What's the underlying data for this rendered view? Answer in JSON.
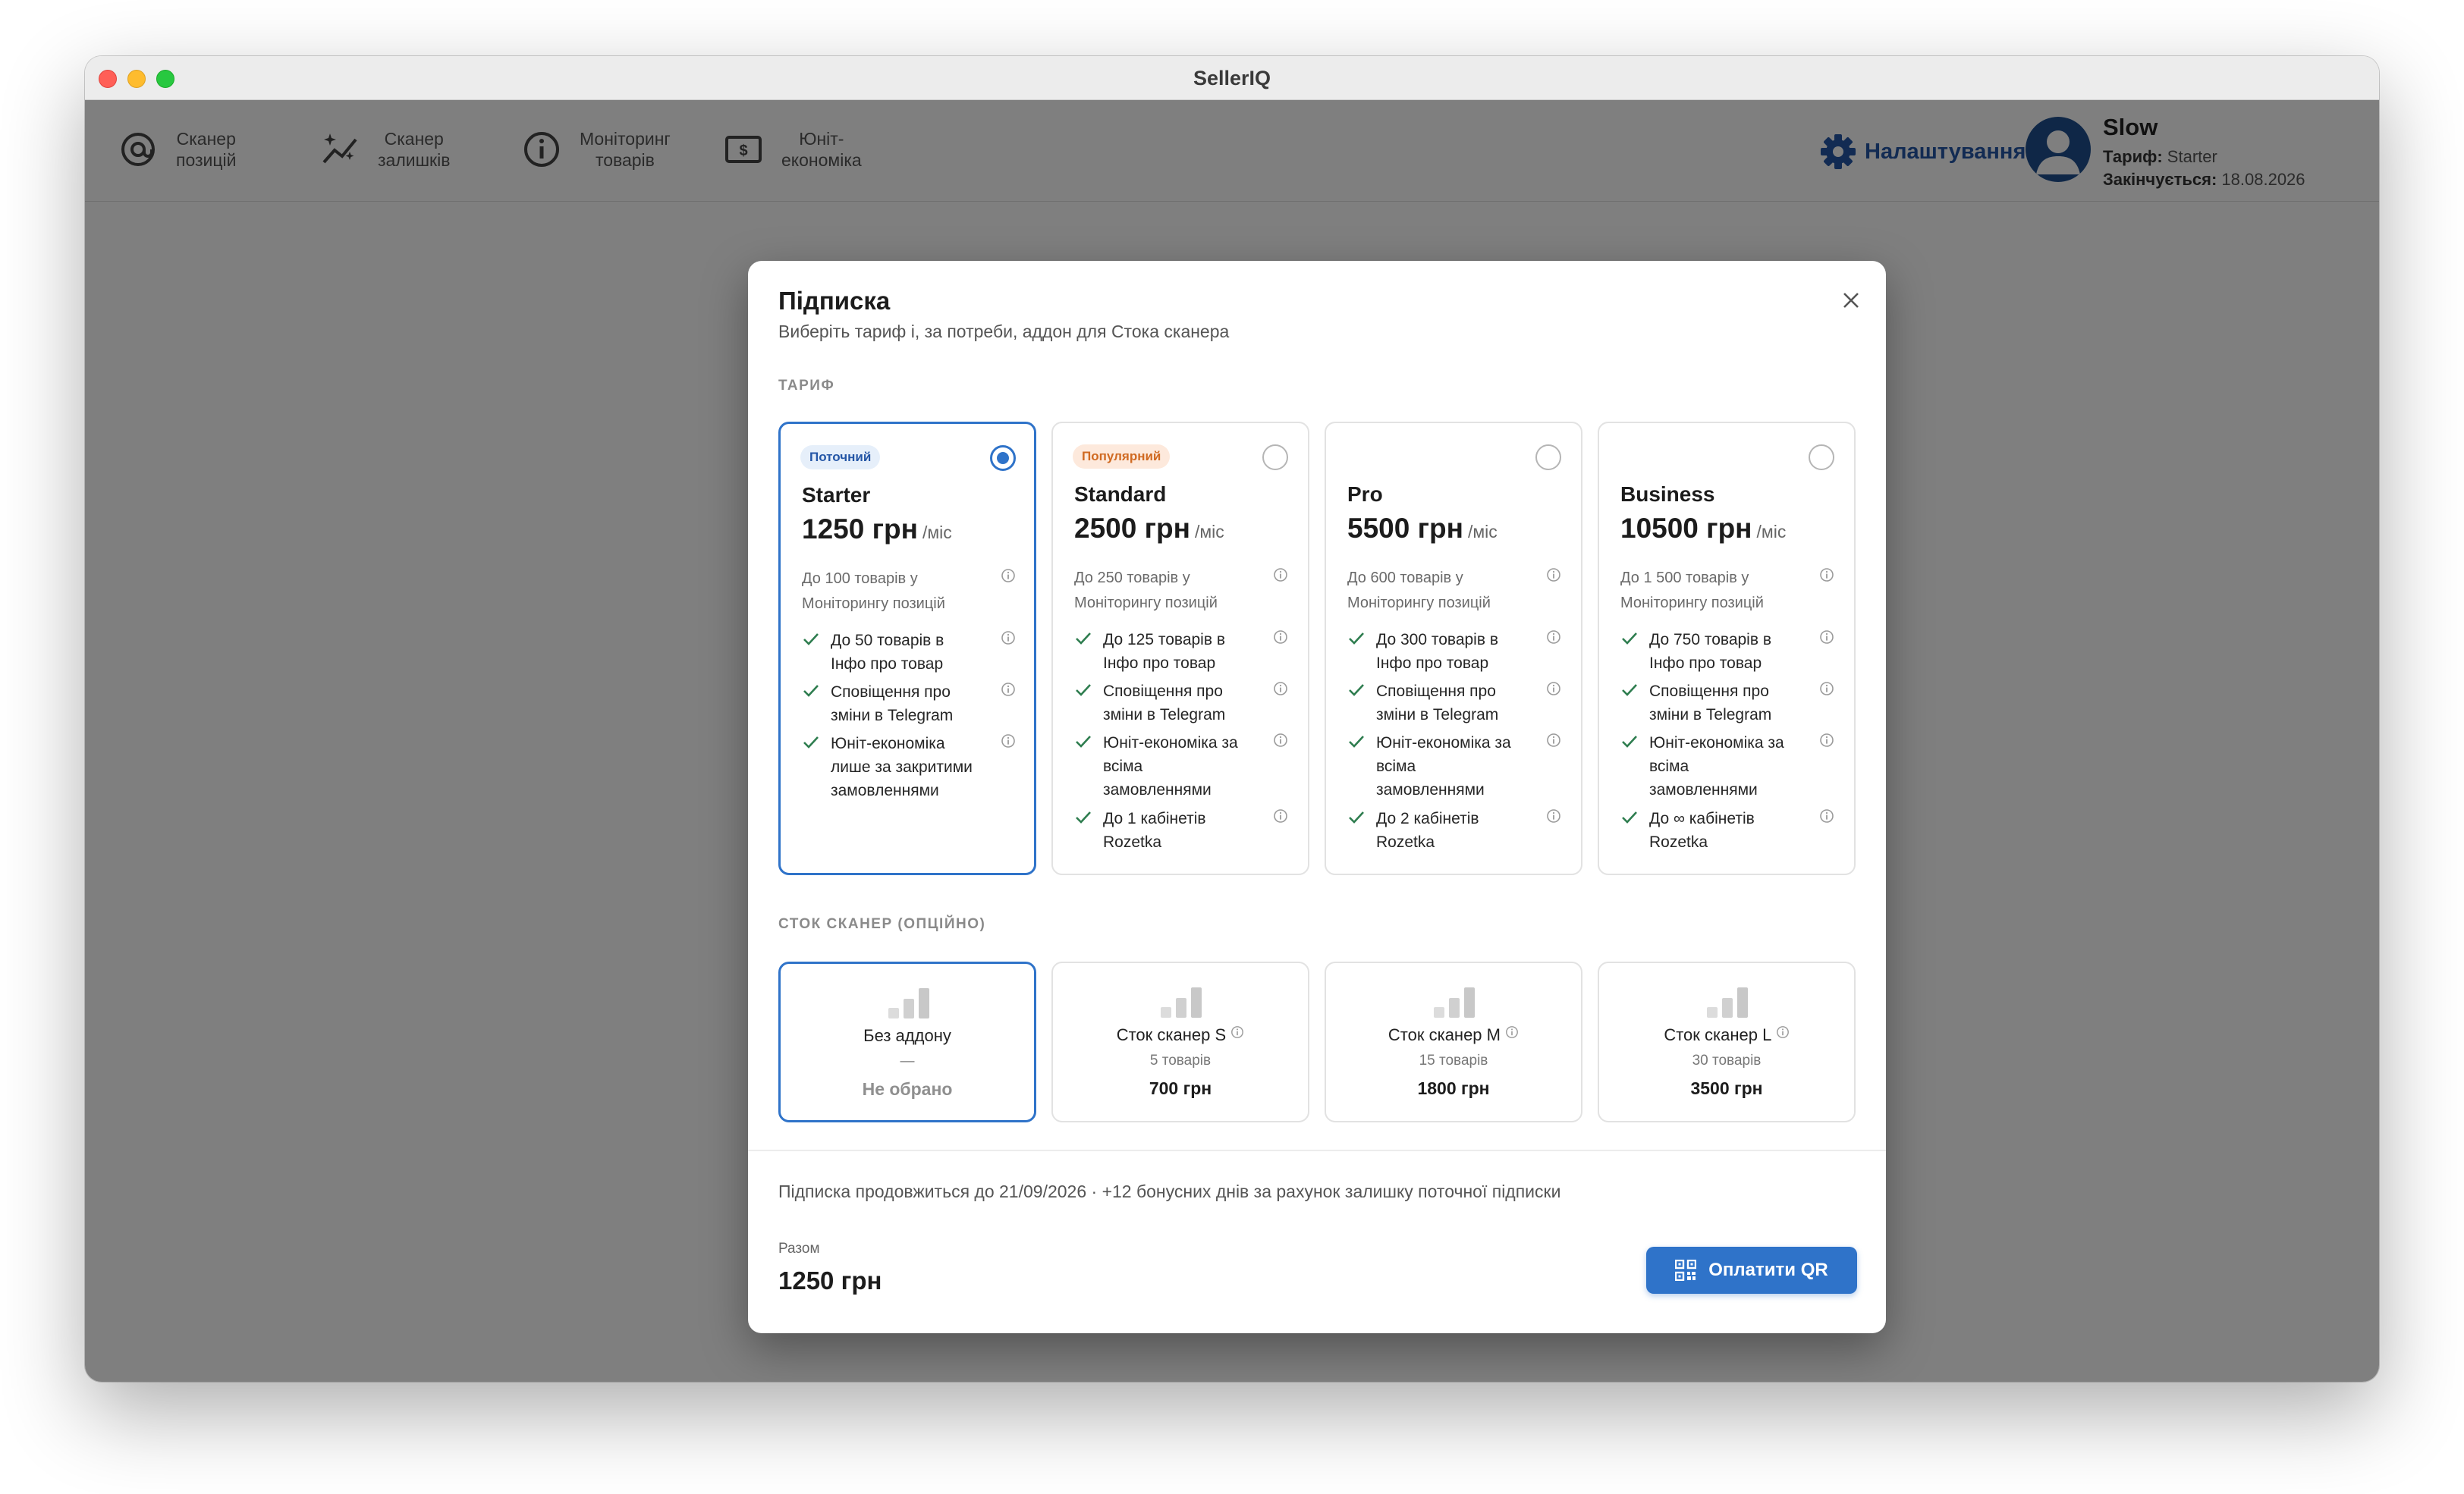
{
  "window": {
    "title": "SellerIQ"
  },
  "nav": {
    "items": [
      {
        "label_line1": "Сканер",
        "label_line2": "позицій",
        "icon": "at-target-icon"
      },
      {
        "label_line1": "Сканер",
        "label_line2": "залишків",
        "icon": "sparkle-trend-icon"
      },
      {
        "label_line1": "Моніторинг",
        "label_line2": "товарів",
        "icon": "info-circle-icon"
      },
      {
        "label_line1": "Юніт-",
        "label_line2": "економіка",
        "icon": "dollar-bill-icon"
      }
    ],
    "settings_label": "Налаштування"
  },
  "user": {
    "name": "Slow",
    "plan_label": "Тариф:",
    "plan_value": "Starter",
    "expires_label": "Закінчується:",
    "expires_value": "18.08.2026"
  },
  "modal": {
    "title": "Підписка",
    "subtitle": "Виберіть тариф і, за потреби, аддон для Стока сканера",
    "plan_section": "ТАРИФ",
    "addon_section": "СТОК СКАНЕР (ОПЦІЙНО)",
    "plans": [
      {
        "badge": "Поточний",
        "name": "Starter",
        "price": "1250 грн",
        "per": "/міс",
        "selected": true,
        "limit_line1": "До 100 товарів у",
        "limit_line2": "Моніторингу позицій",
        "features": [
          {
            "lines": [
              "До 50 товарів в",
              "Інфо про товар"
            ]
          },
          {
            "lines": [
              "Сповіщення про",
              "зміни в Telegram"
            ]
          },
          {
            "lines": [
              "Юніт-економіка",
              "лише за закритими",
              "замовленнями"
            ]
          }
        ]
      },
      {
        "badge": "Популярний",
        "name": "Standard",
        "price": "2500 грн",
        "per": "/міс",
        "selected": false,
        "limit_line1": "До 250 товарів у",
        "limit_line2": "Моніторингу позицій",
        "features": [
          {
            "lines": [
              "До 125 товарів в",
              "Інфо про товар"
            ]
          },
          {
            "lines": [
              "Сповіщення про",
              "зміни в Telegram"
            ]
          },
          {
            "lines": [
              "Юніт-економіка за",
              "всіма",
              "замовленнями"
            ]
          },
          {
            "lines": [
              "До 1 кабінетів",
              "Rozetka"
            ]
          }
        ]
      },
      {
        "badge": "",
        "name": "Pro",
        "price": "5500 грн",
        "per": "/міс",
        "selected": false,
        "limit_line1": "До 600 товарів у",
        "limit_line2": "Моніторингу позицій",
        "features": [
          {
            "lines": [
              "До 300 товарів в",
              "Інфо про товар"
            ]
          },
          {
            "lines": [
              "Сповіщення про",
              "зміни в Telegram"
            ]
          },
          {
            "lines": [
              "Юніт-економіка за",
              "всіма",
              "замовленнями"
            ]
          },
          {
            "lines": [
              "До 2 кабінетів",
              "Rozetka"
            ]
          }
        ]
      },
      {
        "badge": "",
        "name": "Business",
        "price": "10500 грн",
        "per": "/міс",
        "selected": false,
        "limit_line1": "До 1 500 товарів у",
        "limit_line2": "Моніторингу позицій",
        "features": [
          {
            "lines": [
              "До 750 товарів в",
              "Інфо про товар"
            ]
          },
          {
            "lines": [
              "Сповіщення про",
              "зміни в Telegram"
            ]
          },
          {
            "lines": [
              "Юніт-економіка за",
              "всіма",
              "замовленнями"
            ]
          },
          {
            "lines": [
              "До ∞ кабінетів",
              "Rozetka"
            ]
          }
        ]
      }
    ],
    "addons": [
      {
        "name": "Без аддону",
        "count": "—",
        "price": "Не обрано",
        "selected": true,
        "info": false
      },
      {
        "name": "Сток сканер S",
        "count": "5 товарів",
        "price": "700 грн",
        "selected": false,
        "info": true
      },
      {
        "name": "Сток сканер M",
        "count": "15 товарів",
        "price": "1800 грн",
        "selected": false,
        "info": true
      },
      {
        "name": "Сток сканер L",
        "count": "30 товарів",
        "price": "3500 грн",
        "selected": false,
        "info": true
      }
    ],
    "note": "Підписка продовжиться до 21/09/2026 · +12 бонусних днів за рахунок залишку поточної підписки",
    "total_label": "Разом",
    "total_value": "1250 грн",
    "pay_button": "Оплатити QR"
  },
  "colors": {
    "accent": "#2f73c9",
    "accent_dark": "#2456a6",
    "popular": "#d06a22",
    "check": "#2e7d4f"
  }
}
